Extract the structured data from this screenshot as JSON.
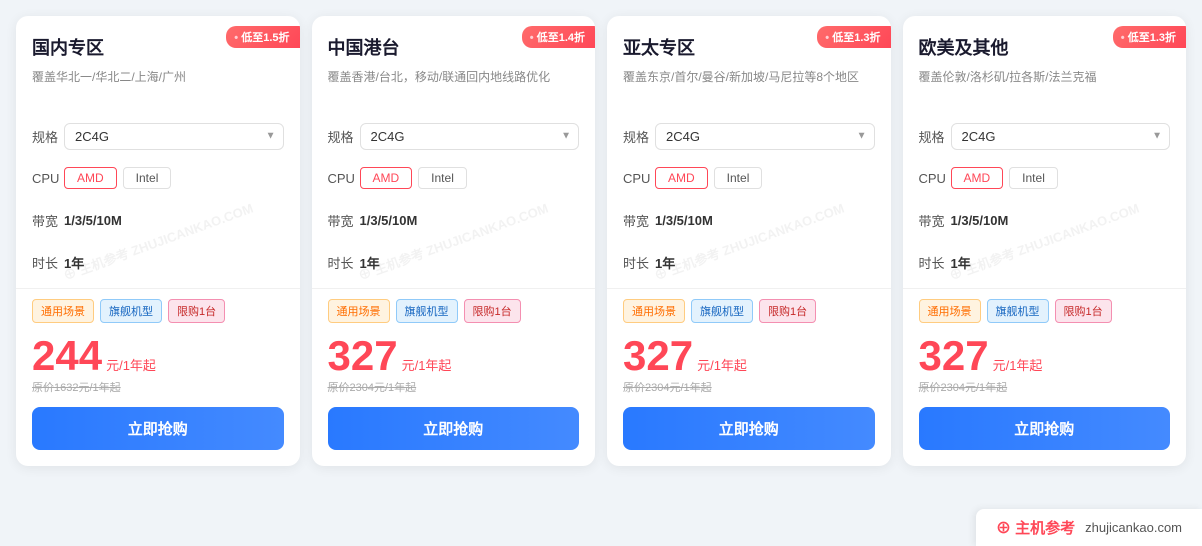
{
  "cards": [
    {
      "id": "domestic",
      "badge": "低至1.5折",
      "title": "国内专区",
      "desc": "覆盖华北一/华北二/上海/广州",
      "spec": "2C4G",
      "cpu_options": [
        "AMD",
        "Intel"
      ],
      "cpu_active": "AMD",
      "bandwidth": "1/3/5/10M",
      "duration": "1年",
      "tags": [
        "通用场景",
        "旗舰机型",
        "限购1台"
      ],
      "price": "244",
      "price_unit": "元/1年起",
      "price_original": "原价1632元/1年起",
      "buy_label": "立即抢购"
    },
    {
      "id": "hktw",
      "badge": "低至1.4折",
      "title": "中国港台",
      "desc": "覆盖香港/台北，移动/联通回内地线路优化",
      "spec": "2C4G",
      "cpu_options": [
        "AMD",
        "Intel"
      ],
      "cpu_active": "AMD",
      "bandwidth": "1/3/5/10M",
      "duration": "1年",
      "tags": [
        "通用场景",
        "旗舰机型",
        "限购1台"
      ],
      "price": "327",
      "price_unit": "元/1年起",
      "price_original": "原价2304元/1年起",
      "buy_label": "立即抢购"
    },
    {
      "id": "apac",
      "badge": "低至1.3折",
      "title": "亚太专区",
      "desc": "覆盖东京/首尔/曼谷/新加坡/马尼拉等8个地区",
      "spec": "2C4G",
      "cpu_options": [
        "AMD",
        "Intel"
      ],
      "cpu_active": "AMD",
      "bandwidth": "1/3/5/10M",
      "duration": "1年",
      "tags": [
        "通用场景",
        "旗舰机型",
        "限购1台"
      ],
      "price": "327",
      "price_unit": "元/1年起",
      "price_original": "原价2304元/1年起",
      "buy_label": "立即抢购"
    },
    {
      "id": "global",
      "badge": "低至1.3折",
      "title": "欧美及其他",
      "desc": "覆盖伦敦/洛杉矶/拉各斯/法兰克福",
      "spec": "2C4G",
      "cpu_options": [
        "AMD",
        "Intel"
      ],
      "cpu_active": "AMD",
      "bandwidth": "1/3/5/10M",
      "duration": "1年",
      "tags": [
        "通用场景",
        "旗舰机型",
        "限购1台"
      ],
      "price": "327",
      "price_unit": "元/1年起",
      "price_original": "原价2304元/1年起",
      "buy_label": "立即抢购"
    }
  ],
  "labels": {
    "spec": "规格",
    "cpu": "CPU",
    "bandwidth": "带宽",
    "duration": "时长"
  },
  "footer": {
    "logo": "⊕ 主机参考",
    "url": "zhujicankao.com"
  }
}
